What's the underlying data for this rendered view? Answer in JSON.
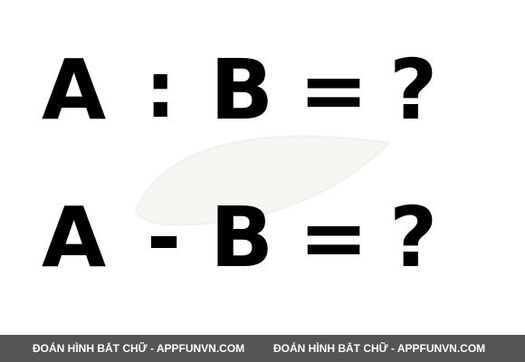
{
  "puzzle": {
    "equation_1": {
      "left_operand": "A",
      "operator": ":",
      "right_operand": "B",
      "equals": "=",
      "result": "?"
    },
    "equation_2": {
      "left_operand": "A",
      "operator": "-",
      "right_operand": "B",
      "equals": "=",
      "result": "?"
    }
  },
  "footer": {
    "watermark_1": "ĐOÁN HÌNH BẮT CHỮ - APPFUNVN.COM",
    "watermark_2": "ĐOÁN HÌNH BẮT CHỮ - APPFUNVN.COM"
  },
  "colors": {
    "text": "#000000",
    "footer_bg": "#555555",
    "footer_text": "#ffffff",
    "watermark_shape": "#f3f6f1"
  },
  "icons": {
    "background": "leaf-watermark-icon"
  }
}
